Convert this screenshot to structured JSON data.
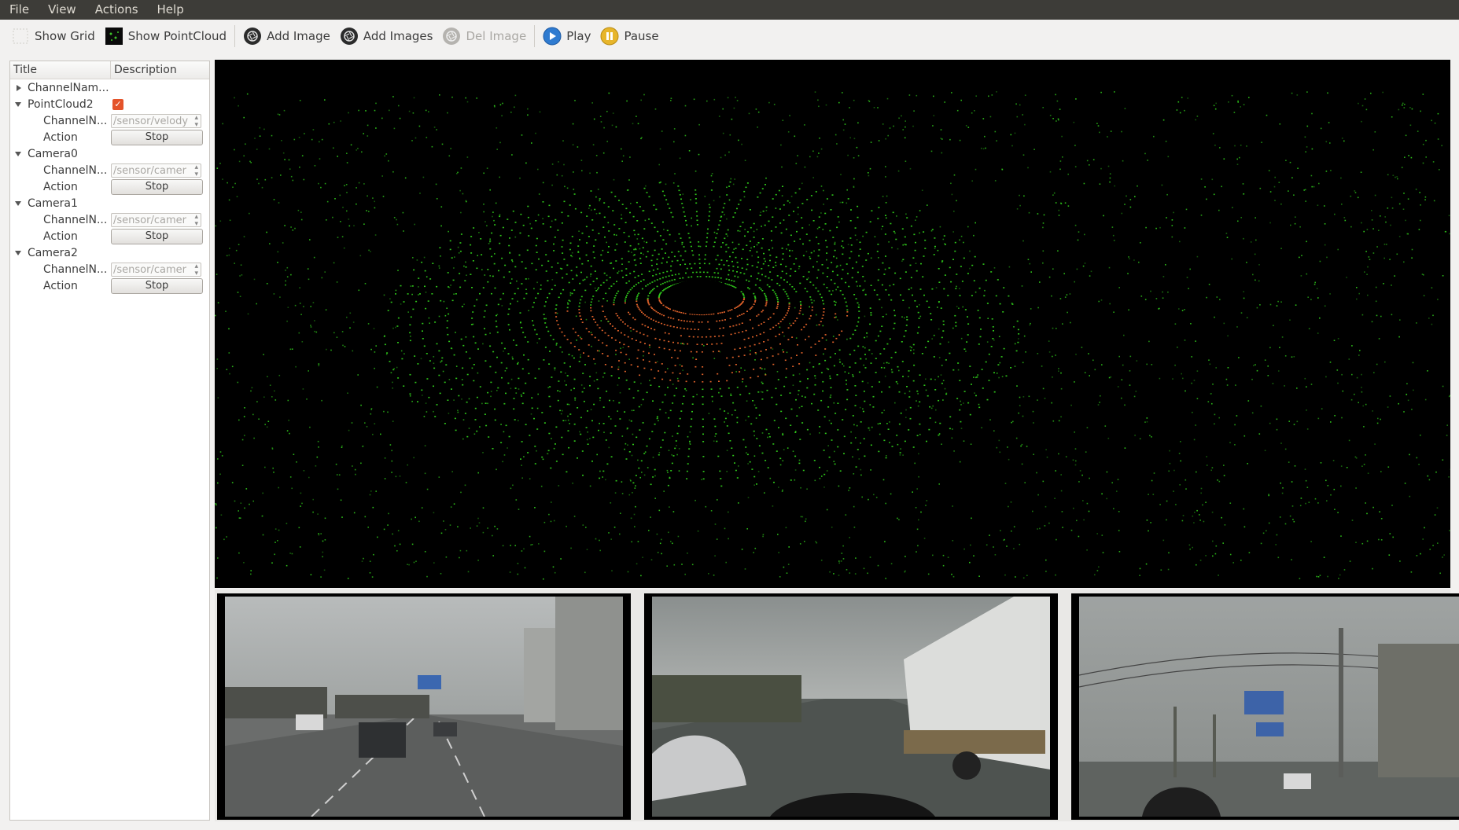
{
  "menubar": {
    "items": [
      "File",
      "View",
      "Actions",
      "Help"
    ]
  },
  "toolbar": {
    "show_grid": "Show Grid",
    "show_pointcloud": "Show PointCloud",
    "add_image": "Add Image",
    "add_images": "Add Images",
    "del_image": "Del Image",
    "play": "Play",
    "pause": "Pause"
  },
  "tree": {
    "headers": {
      "title": "Title",
      "description": "Description"
    },
    "top_item": "ChannelNam...",
    "groups": [
      {
        "title": "PointCloud2",
        "checked": true,
        "channel_label": "ChannelN...",
        "channel_value": "/sensor/velody",
        "action_label": "Action",
        "action_button": "Stop"
      },
      {
        "title": "Camera0",
        "channel_label": "ChannelN...",
        "channel_value": "/sensor/camer",
        "action_label": "Action",
        "action_button": "Stop"
      },
      {
        "title": "Camera1",
        "channel_label": "ChannelN...",
        "channel_value": "/sensor/camer",
        "action_label": "Action",
        "action_button": "Stop"
      },
      {
        "title": "Camera2",
        "channel_label": "ChannelN...",
        "channel_value": "/sensor/camer",
        "action_label": "Action",
        "action_button": "Stop"
      }
    ]
  },
  "colors": {
    "menubar_bg": "#3d3c38",
    "accent_check": "#e4532a",
    "pointcloud_near": "#e0622a",
    "pointcloud_far": "#2ec41a"
  }
}
